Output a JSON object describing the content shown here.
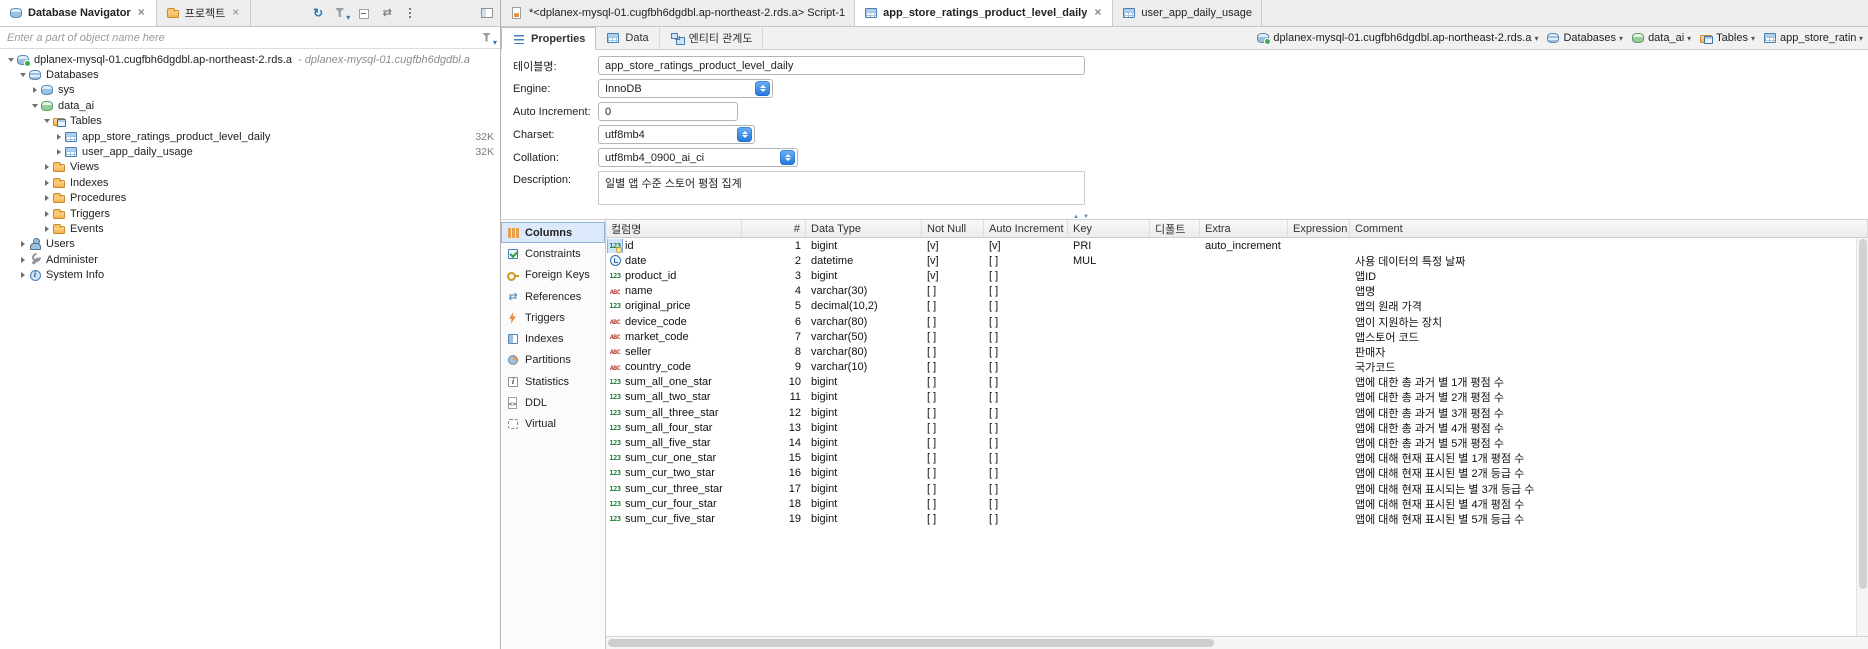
{
  "colors": {
    "accent": "#2e75b6",
    "selection": "#d6e6f8"
  },
  "left": {
    "tabs": [
      {
        "icon": "database-navigator",
        "label": "Database Navigator",
        "active": true,
        "close": true
      },
      {
        "icon": "projects",
        "label": "프로젝트",
        "active": false,
        "close": true
      }
    ],
    "toolbar": [
      {
        "icon": "sync"
      },
      {
        "icon": "funnel-dropdown"
      },
      {
        "icon": "collapse-all"
      },
      {
        "icon": "link-editor"
      },
      {
        "icon": "kebab-menu"
      },
      {
        "icon": "layout-panel"
      }
    ],
    "filter": {
      "placeholder": "Enter a part of object name here"
    },
    "tree": [
      {
        "level": 0,
        "arrow": "down",
        "icon": "server",
        "label": "dplanex-mysql-01.cugfbh6dgdbl.ap-northeast-2.rds.a",
        "suffix": "- dplanex-mysql-01.cugfbh6dgdbl.a"
      },
      {
        "level": 1,
        "arrow": "down",
        "icon": "db-stack",
        "label": "Databases"
      },
      {
        "level": 2,
        "arrow": "right",
        "icon": "database",
        "label": "sys"
      },
      {
        "level": 2,
        "arrow": "down",
        "icon": "database-green",
        "label": "data_ai"
      },
      {
        "level": 3,
        "arrow": "down",
        "icon": "folder-table",
        "label": "Tables"
      },
      {
        "level": 4,
        "arrow": "right",
        "icon": "table",
        "label": "app_store_ratings_product_level_daily",
        "badge": "32K"
      },
      {
        "level": 4,
        "arrow": "right",
        "icon": "table",
        "label": "user_app_daily_usage",
        "badge": "32K"
      },
      {
        "level": 3,
        "arrow": "right",
        "icon": "folder-view",
        "label": "Views"
      },
      {
        "level": 3,
        "arrow": "right",
        "icon": "folder",
        "label": "Indexes"
      },
      {
        "level": 3,
        "arrow": "right",
        "icon": "folder",
        "label": "Procedures"
      },
      {
        "level": 3,
        "arrow": "right",
        "icon": "folder",
        "label": "Triggers"
      },
      {
        "level": 3,
        "arrow": "right",
        "icon": "folder",
        "label": "Events"
      },
      {
        "level": 1,
        "arrow": "right",
        "icon": "users",
        "label": "Users"
      },
      {
        "level": 1,
        "arrow": "right",
        "icon": "admin",
        "label": "Administer"
      },
      {
        "level": 1,
        "arrow": "right",
        "icon": "sysinfo",
        "label": "System Info"
      }
    ]
  },
  "editor": {
    "tabs": [
      {
        "icon": "sql-script",
        "label": "*<dplanex-mysql-01.cugfbh6dgdbl.ap-northeast-2.rds.a> Script-1",
        "active": false,
        "close": false
      },
      {
        "icon": "table",
        "label": "app_store_ratings_product_level_daily",
        "active": true,
        "close": true
      },
      {
        "icon": "table",
        "label": "user_app_daily_usage",
        "active": false,
        "close": false
      }
    ],
    "subtabs": [
      {
        "icon": "properties",
        "label": "Properties",
        "active": true
      },
      {
        "icon": "data-grid",
        "label": "Data",
        "active": false
      },
      {
        "icon": "erd",
        "label": "엔티티 관계도",
        "active": false
      }
    ],
    "breadcrumb": [
      {
        "icon": "server",
        "label": "dplanex-mysql-01.cugfbh6dgdbl.ap-northeast-2.rds.a"
      },
      {
        "icon": "db-stack",
        "label": "Databases"
      },
      {
        "icon": "database-green",
        "label": "data_ai"
      },
      {
        "icon": "folder-table",
        "label": "Tables"
      },
      {
        "icon": "table",
        "label": "app_store_ratings_product_level_daily"
      }
    ],
    "form": {
      "table_name_label": "테이블명:",
      "table_name": "app_store_ratings_product_level_daily",
      "engine_label": "Engine:",
      "engine": "InnoDB",
      "auto_increment_label": "Auto Increment:",
      "auto_increment": "0",
      "charset_label": "Charset:",
      "charset": "utf8mb4",
      "collation_label": "Collation:",
      "collation": "utf8mb4_0900_ai_ci",
      "description_label": "Description:",
      "description": "일별 앱 수준 스토어 평점 집계"
    },
    "side_tabs": [
      {
        "icon": "columns",
        "label": "Columns",
        "active": true
      },
      {
        "icon": "constraints",
        "label": "Constraints",
        "active": false
      },
      {
        "icon": "foreign-key",
        "label": "Foreign Keys",
        "active": false
      },
      {
        "icon": "references",
        "label": "References",
        "active": false
      },
      {
        "icon": "trigger",
        "label": "Triggers",
        "active": false
      },
      {
        "icon": "index",
        "label": "Indexes",
        "active": false
      },
      {
        "icon": "partition",
        "label": "Partitions",
        "active": false
      },
      {
        "icon": "statistics",
        "label": "Statistics",
        "active": false
      },
      {
        "icon": "ddl",
        "label": "DDL",
        "active": false
      },
      {
        "icon": "virtual",
        "label": "Virtual",
        "active": false
      }
    ],
    "grid": {
      "headers": [
        {
          "label": "컬럼명"
        },
        {
          "label": "#",
          "align": "right"
        },
        {
          "label": "Data Type"
        },
        {
          "label": "Not Null"
        },
        {
          "label": "Auto Increment"
        },
        {
          "label": "Key"
        },
        {
          "label": "디폴트"
        },
        {
          "label": "Extra"
        },
        {
          "label": "Expression"
        },
        {
          "label": "Comment"
        }
      ],
      "rows": [
        {
          "icon": "pk-number",
          "name": "id",
          "num": "1",
          "type": "bigint",
          "notnull": "[v]",
          "autoinc": "[v]",
          "key": "PRI",
          "def": "",
          "extra": "auto_increment",
          "expr": "",
          "comment": ""
        },
        {
          "icon": "datetime",
          "name": "date",
          "num": "2",
          "type": "datetime",
          "notnull": "[v]",
          "autoinc": "[ ]",
          "key": "MUL",
          "def": "",
          "extra": "",
          "expr": "",
          "comment": "사용 데이터의 특정 날짜"
        },
        {
          "icon": "number",
          "name": "product_id",
          "num": "3",
          "type": "bigint",
          "notnull": "[v]",
          "autoinc": "[ ]",
          "key": "",
          "def": "",
          "extra": "",
          "expr": "",
          "comment": "앱ID"
        },
        {
          "icon": "string",
          "name": "name",
          "num": "4",
          "type": "varchar(30)",
          "notnull": "[ ]",
          "autoinc": "[ ]",
          "key": "",
          "def": "",
          "extra": "",
          "expr": "",
          "comment": "앱명"
        },
        {
          "icon": "number",
          "name": "original_price",
          "num": "5",
          "type": "decimal(10,2)",
          "notnull": "[ ]",
          "autoinc": "[ ]",
          "key": "",
          "def": "",
          "extra": "",
          "expr": "",
          "comment": "앱의 원래 가격"
        },
        {
          "icon": "string",
          "name": "device_code",
          "num": "6",
          "type": "varchar(80)",
          "notnull": "[ ]",
          "autoinc": "[ ]",
          "key": "",
          "def": "",
          "extra": "",
          "expr": "",
          "comment": "앱이 지원하는 장치"
        },
        {
          "icon": "string",
          "name": "market_code",
          "num": "7",
          "type": "varchar(50)",
          "notnull": "[ ]",
          "autoinc": "[ ]",
          "key": "",
          "def": "",
          "extra": "",
          "expr": "",
          "comment": "앱스토어 코드"
        },
        {
          "icon": "string",
          "name": "seller",
          "num": "8",
          "type": "varchar(80)",
          "notnull": "[ ]",
          "autoinc": "[ ]",
          "key": "",
          "def": "",
          "extra": "",
          "expr": "",
          "comment": "판매자"
        },
        {
          "icon": "string",
          "name": "country_code",
          "num": "9",
          "type": "varchar(10)",
          "notnull": "[ ]",
          "autoinc": "[ ]",
          "key": "",
          "def": "",
          "extra": "",
          "expr": "",
          "comment": "국가코드"
        },
        {
          "icon": "number",
          "name": "sum_all_one_star",
          "num": "10",
          "type": "bigint",
          "notnull": "[ ]",
          "autoinc": "[ ]",
          "key": "",
          "def": "",
          "extra": "",
          "expr": "",
          "comment": "앱에 대한 총 과거 별 1개 평점 수"
        },
        {
          "icon": "number",
          "name": "sum_all_two_star",
          "num": "11",
          "type": "bigint",
          "notnull": "[ ]",
          "autoinc": "[ ]",
          "key": "",
          "def": "",
          "extra": "",
          "expr": "",
          "comment": "앱에 대한 총 과거 별 2개 평점 수"
        },
        {
          "icon": "number",
          "name": "sum_all_three_star",
          "num": "12",
          "type": "bigint",
          "notnull": "[ ]",
          "autoinc": "[ ]",
          "key": "",
          "def": "",
          "extra": "",
          "expr": "",
          "comment": "앱에 대한 총 과거 별 3개 평점 수"
        },
        {
          "icon": "number",
          "name": "sum_all_four_star",
          "num": "13",
          "type": "bigint",
          "notnull": "[ ]",
          "autoinc": "[ ]",
          "key": "",
          "def": "",
          "extra": "",
          "expr": "",
          "comment": "앱에 대한 총 과거 별 4개 평점 수"
        },
        {
          "icon": "number",
          "name": "sum_all_five_star",
          "num": "14",
          "type": "bigint",
          "notnull": "[ ]",
          "autoinc": "[ ]",
          "key": "",
          "def": "",
          "extra": "",
          "expr": "",
          "comment": "앱에 대한 총 과거 별 5개 평점 수"
        },
        {
          "icon": "number",
          "name": "sum_cur_one_star",
          "num": "15",
          "type": "bigint",
          "notnull": "[ ]",
          "autoinc": "[ ]",
          "key": "",
          "def": "",
          "extra": "",
          "expr": "",
          "comment": "앱에 대해 현재 표시된 별 1개 평점 수"
        },
        {
          "icon": "number",
          "name": "sum_cur_two_star",
          "num": "16",
          "type": "bigint",
          "notnull": "[ ]",
          "autoinc": "[ ]",
          "key": "",
          "def": "",
          "extra": "",
          "expr": "",
          "comment": "앱에 대해 현재 표시된 별 2개 등급 수"
        },
        {
          "icon": "number",
          "name": "sum_cur_three_star",
          "num": "17",
          "type": "bigint",
          "notnull": "[ ]",
          "autoinc": "[ ]",
          "key": "",
          "def": "",
          "extra": "",
          "expr": "",
          "comment": "앱에 대해 현재 표시되는 별 3개 등급 수"
        },
        {
          "icon": "number",
          "name": "sum_cur_four_star",
          "num": "18",
          "type": "bigint",
          "notnull": "[ ]",
          "autoinc": "[ ]",
          "key": "",
          "def": "",
          "extra": "",
          "expr": "",
          "comment": "앱에 대해 현재 표시된 별 4개 평점 수"
        },
        {
          "icon": "number",
          "name": "sum_cur_five_star",
          "num": "19",
          "type": "bigint",
          "notnull": "[ ]",
          "autoinc": "[ ]",
          "key": "",
          "def": "",
          "extra": "",
          "expr": "",
          "comment": "앱에 대해 현재 표시된 별 5개 등급 수"
        }
      ]
    }
  }
}
